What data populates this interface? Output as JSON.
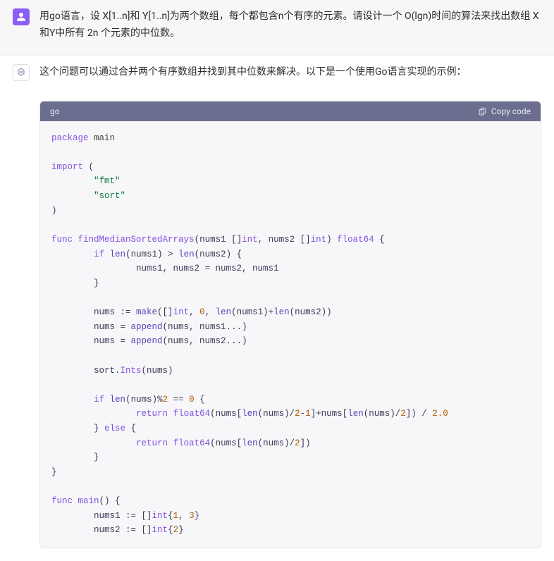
{
  "user_message": "用go语言，设 X[1..n]和 Y[1..n]为两个数组，每个都包含n个有序的元素。请设计一个 O(lgn)时间的算法来找出数组 X和Y中所有 2n 个元素的中位数。",
  "assistant_message": "这个问题可以通过合并两个有序数组并找到其中位数来解决。以下是一个使用Go语言实现的示例：",
  "code": {
    "lang": "go",
    "copy_label": "Copy code"
  }
}
